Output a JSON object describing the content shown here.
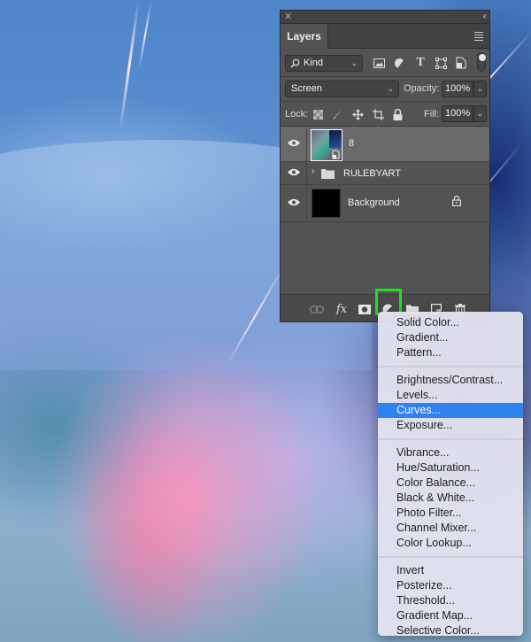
{
  "panel": {
    "title_tab": "Layers",
    "close_icon": "close-icon",
    "collapse_icon": "collapse-double-chevron-icon",
    "menu_icon": "panel-menu-icon",
    "filter": {
      "kind_label": "Kind",
      "icons": [
        "pixel-filter-icon",
        "adjustment-filter-icon",
        "type-filter-icon",
        "shape-filter-icon",
        "smart-object-filter-icon"
      ],
      "toggle": "filter-toggle"
    },
    "blend_mode": "Screen",
    "opacity_label": "Opacity:",
    "opacity_value": "100%",
    "lock_label": "Lock:",
    "lock_icons": [
      "lock-transparent-pixels-icon",
      "lock-image-pixels-icon",
      "lock-position-icon",
      "lock-artboard-icon",
      "lock-all-icon"
    ],
    "fill_label": "Fill:",
    "fill_value": "100%",
    "layers": [
      {
        "name": "8",
        "type": "smart-object",
        "visible": true,
        "selected": true
      },
      {
        "name": "RULEBYART",
        "type": "group",
        "visible": true,
        "selected": false,
        "collapsed": true
      },
      {
        "name": "Background",
        "type": "background",
        "visible": true,
        "selected": false,
        "locked": true
      }
    ],
    "footer_icons": [
      "link-layers-icon",
      "fx-icon",
      "add-mask-icon",
      "adjustment-layer-icon",
      "new-group-icon",
      "new-layer-icon",
      "delete-layer-icon"
    ],
    "footer_fx_label": "fx",
    "highlight_color": "#20e020"
  },
  "menu": {
    "groups": [
      [
        "Solid Color...",
        "Gradient...",
        "Pattern..."
      ],
      [
        "Brightness/Contrast...",
        "Levels...",
        "Curves...",
        "Exposure..."
      ],
      [
        "Vibrance...",
        "Hue/Saturation...",
        "Color Balance...",
        "Black & White...",
        "Photo Filter...",
        "Channel Mixer...",
        "Color Lookup..."
      ],
      [
        "Invert",
        "Posterize...",
        "Threshold...",
        "Gradient Map...",
        "Selective Color..."
      ]
    ],
    "active_item": "Curves...",
    "active_color": "#2f83ee"
  }
}
